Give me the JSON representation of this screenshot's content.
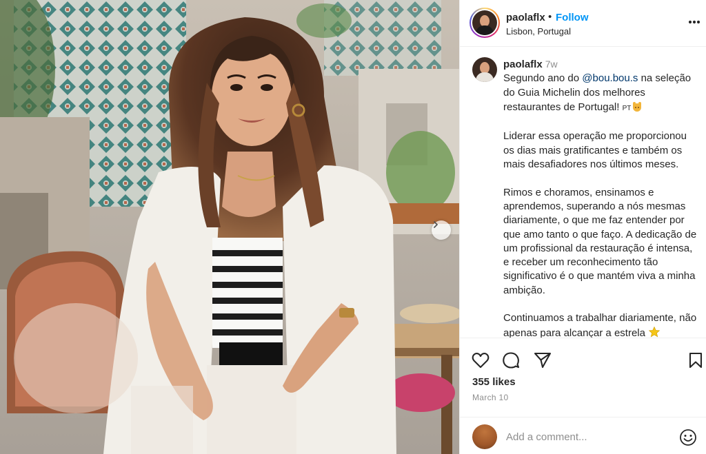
{
  "post": {
    "username": "paolaflx",
    "separator": "•",
    "follow_label": "Follow",
    "location": "Lisbon, Portugal",
    "more_icon": "more-horizontal-icon",
    "image_alt": "Woman in white blazer and striped top seated at a restaurant table"
  },
  "caption": {
    "username": "paolaflx",
    "time": "7w",
    "line_intro_before": "Segundo ano do ",
    "mention": "@bou.bou.s",
    "line_intro_after": " na seleção do Guia Michelin dos melhores restaurantes de Portugal! ",
    "flag_text": "PT",
    "paragraph_2": "Liderar essa operação me proporcionou os dias mais gratificantes e também os mais desafiadores nos últimos meses.",
    "paragraph_3": "Rimos e choramos, ensinamos e aprendemos, superando a nós mesmas diariamente, o que me faz entender por que amo tanto o que faço. A dedicação de um profissional da restauração é intensa, e receber um reconhecimento tão significativo é o que mantém viva a minha ambição.",
    "paragraph_4": "Continuamos a trabalhar diariamente, não apenas para alcançar a estrela "
  },
  "actions": {
    "like_icon": "heart-icon",
    "comment_icon": "comment-bubble-icon",
    "share_icon": "send-paper-plane-icon",
    "save_icon": "bookmark-icon",
    "likes": "355 likes",
    "date": "March 10"
  },
  "comment_box": {
    "placeholder": "Add a comment...",
    "emoji_icon": "smiley-face-icon"
  },
  "colors": {
    "follow_blue": "#0095f6",
    "mention_blue": "#00376b",
    "text": "#262626",
    "muted": "#8e8e8e",
    "divider": "#efefef"
  }
}
